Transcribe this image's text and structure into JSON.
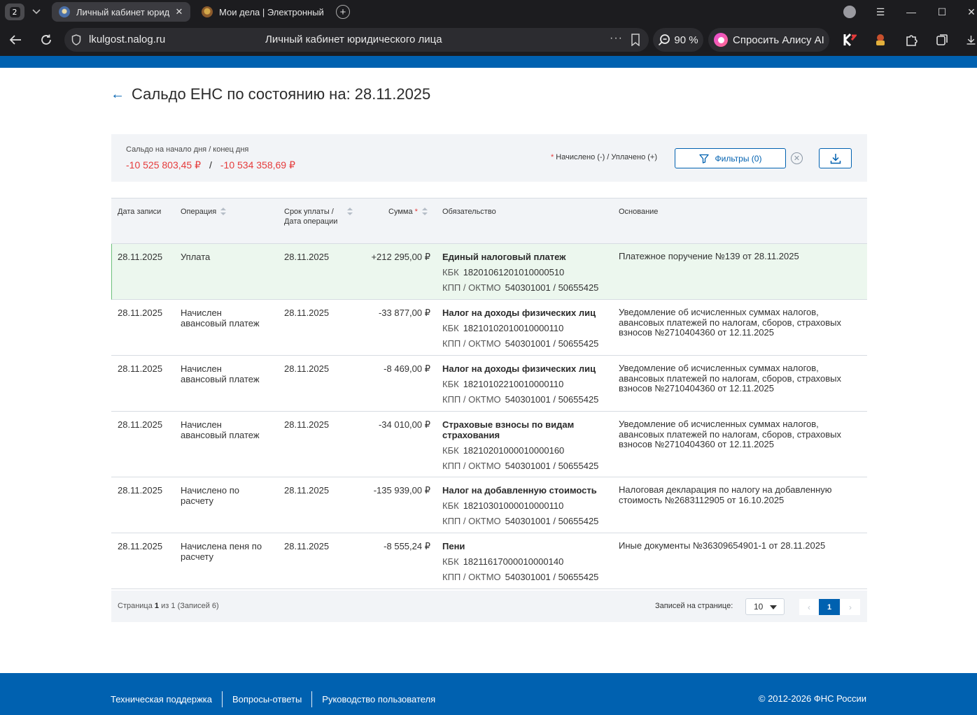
{
  "browser": {
    "tab_count": "2",
    "tabs": [
      {
        "title": "Личный кабинет юрид",
        "close": "✕"
      },
      {
        "title": "Мои дела | Электронный"
      }
    ],
    "new_tab": "+",
    "window_controls": {
      "menu": "☰",
      "minimize": "—",
      "maximize": "☐",
      "close": "✕"
    },
    "address": {
      "host": "lkulgost.nalog.ru",
      "page_title": "Личный кабинет юридического лица",
      "more": "···"
    },
    "zoom": "90 %",
    "alice": "Спросить Алису AI"
  },
  "page": {
    "title": "Сальдо ЕНС по состоянию на: 28.11.2025",
    "back_icon": "←"
  },
  "saldo": {
    "label": "Сальдо на начало дня / конец дня",
    "start": "-10 525 803,45 ₽",
    "separator": "/",
    "end": "-10 534 358,69 ₽",
    "legend_star": "*",
    "legend": "Начислено (-) / Уплачено (+)",
    "filter_button": "Фильтры (0)",
    "clear_icon": "✕"
  },
  "table": {
    "headers": {
      "date": "Дата записи",
      "operation": "Операция",
      "due": "Срок уплаты / Дата операции",
      "amount": "Сумма",
      "amount_star": "*",
      "obligation": "Обязательство",
      "basis": "Основание"
    },
    "labels": {
      "kbk": "КБК",
      "kpp_oktmo": "КПП / ОКТМО"
    },
    "rows": [
      {
        "date": "28.11.2025",
        "operation": "Уплата",
        "due": "28.11.2025",
        "amount": "+212 295,00 ₽",
        "obligation": "Единый налоговый платеж",
        "kbk": "18201061201010000510",
        "kpp_oktmo": "540301001 / 50655425",
        "basis": "Платежное поручение №139 от 28.11.2025"
      },
      {
        "date": "28.11.2025",
        "operation": "Начислен авансовый платеж",
        "due": "28.11.2025",
        "amount": "-33 877,00 ₽",
        "obligation": "Налог на доходы физических лиц",
        "kbk": "18210102010010000110",
        "kpp_oktmo": "540301001 / 50655425",
        "basis": "Уведомление об исчисленных суммах налогов, авансовых платежей по налогам, сборов, страховых взносов №2710404360 от 12.11.2025"
      },
      {
        "date": "28.11.2025",
        "operation": "Начислен авансовый платеж",
        "due": "28.11.2025",
        "amount": "-8 469,00 ₽",
        "obligation": "Налог на доходы физических лиц",
        "kbk": "18210102210010000110",
        "kpp_oktmo": "540301001 / 50655425",
        "basis": "Уведомление об исчисленных суммах налогов, авансовых платежей по налогам, сборов, страховых взносов №2710404360 от 12.11.2025"
      },
      {
        "date": "28.11.2025",
        "operation": "Начислен авансовый платеж",
        "due": "28.11.2025",
        "amount": "-34 010,00 ₽",
        "obligation": "Страховые взносы по видам страхования",
        "kbk": "18210201000010000160",
        "kpp_oktmo": "540301001 / 50655425",
        "basis": "Уведомление об исчисленных суммах налогов, авансовых платежей по налогам, сборов, страховых взносов №2710404360 от 12.11.2025"
      },
      {
        "date": "28.11.2025",
        "operation": "Начислено по расчету",
        "due": "28.11.2025",
        "amount": "-135 939,00 ₽",
        "obligation": "Налог на добавленную стоимость",
        "kbk": "18210301000010000110",
        "kpp_oktmo": "540301001 / 50655425",
        "basis": "Налоговая декларация по налогу на добавленную стоимость №2683112905 от 16.10.2025"
      },
      {
        "date": "28.11.2025",
        "operation": "Начислена пеня по расчету",
        "due": "28.11.2025",
        "amount": "-8 555,24 ₽",
        "obligation": "Пени",
        "kbk": "18211617000010000140",
        "kpp_oktmo": "540301001 / 50655425",
        "basis": "Иные документы №36309654901-1 от 28.11.2025"
      }
    ]
  },
  "pager": {
    "info_prefix": "Страница",
    "page": "1",
    "info_mid": "из",
    "total_pages": "1",
    "info_suffix": "(Записей 6)",
    "per_page_label": "Записей на странице:",
    "per_page_value": "10",
    "prev": "‹",
    "next": "›",
    "current": "1"
  },
  "footer": {
    "links": [
      "Техническая поддержка",
      "Вопросы-ответы",
      "Руководство пользователя"
    ],
    "copyright": "© 2012-2026 ФНС России"
  },
  "colors": {
    "brand": "#0061b0",
    "negative": "#e53b3b",
    "paid_row": "#ecf7ee"
  }
}
